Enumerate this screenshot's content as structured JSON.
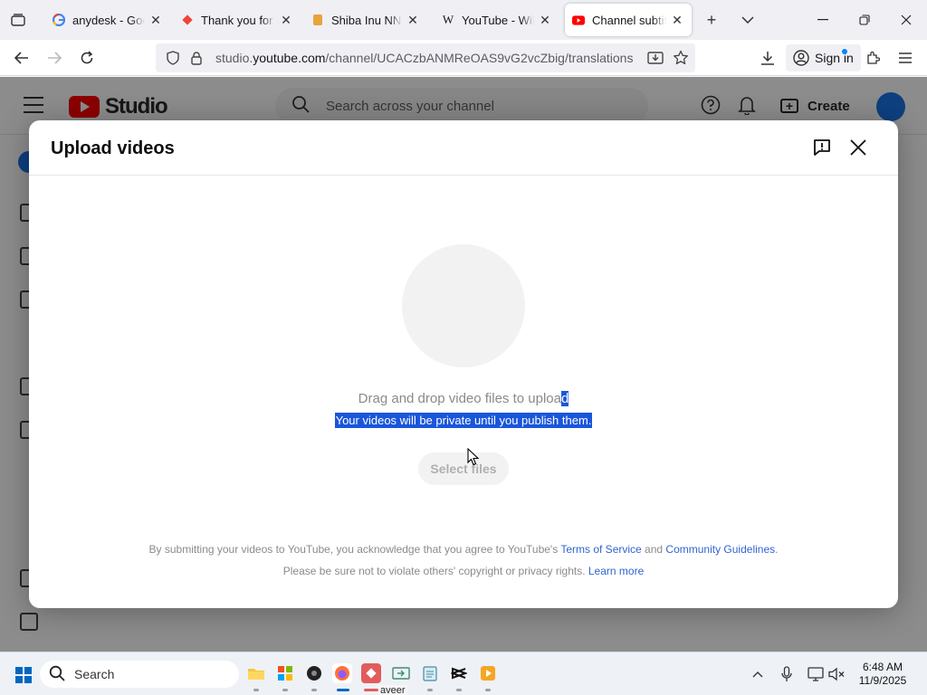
{
  "browser": {
    "tabs": [
      {
        "title": "anydesk - Googl",
        "favicon": "google-icon",
        "active": false
      },
      {
        "title": "Thank you for d",
        "favicon": "anydesk-icon",
        "active": false
      },
      {
        "title": "Shiba Inu NNN",
        "favicon": "bookmark-icon",
        "active": false
      },
      {
        "title": "YouTube - Wikip",
        "favicon": "wikipedia-icon",
        "active": false
      },
      {
        "title": "Channel subtitle",
        "favicon": "youtube-icon",
        "active": true
      }
    ],
    "url_prefix": "studio.",
    "url_domain": "youtube.com",
    "url_path": "/channel/UCACzbANMReOAS9vG2vcZbig/translations",
    "signin_label": "Sign in"
  },
  "studio": {
    "logo_word": "Studio",
    "search_placeholder": "Search across your channel",
    "create_label": "Create"
  },
  "dialog": {
    "title": "Upload videos",
    "drag_text_main": "Drag and drop video files to uploa",
    "drag_text_selected": "d",
    "private_text": "Your videos will be private until you publish them.",
    "select_button": "Select files",
    "legal_line1_text": "By submitting your videos to YouTube, you acknowledge that you agree to YouTube's ",
    "terms_link": "Terms of Service",
    "legal_and": " and ",
    "guidelines_link": "Community Guidelines",
    "legal_period": ".",
    "legal_line2_text": "Please be sure not to violate others' copyright or privacy rights. ",
    "learn_more_link": "Learn more"
  },
  "taskbar": {
    "search_label": "Search",
    "tooltip": "aveer",
    "time": "6:48 AM",
    "date": "11/9/2025"
  },
  "colors": {
    "accent": "#1a56db",
    "link": "#3065d1",
    "youtube_red": "#ff0000"
  }
}
